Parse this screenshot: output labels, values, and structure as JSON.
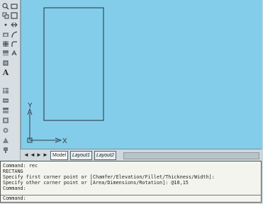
{
  "toolbar": {
    "tools": [
      {
        "name": "zoom-icon"
      },
      {
        "name": "rectangle-icon"
      },
      {
        "name": "copy-icon"
      },
      {
        "name": "rectangle-outline-icon"
      },
      {
        "name": "point-icon"
      },
      {
        "name": "stretch-icon"
      },
      {
        "name": "block-icon"
      },
      {
        "name": "arc-icon"
      },
      {
        "name": "hatch-icon"
      },
      {
        "name": "fillet-icon"
      },
      {
        "name": "gradient-icon"
      },
      {
        "name": "explode-icon"
      },
      {
        "name": "region-icon"
      },
      {
        "name": "text-letter",
        "label": "A"
      },
      {
        "name": "table-icon"
      },
      {
        "name": "dimension-icon"
      },
      {
        "name": "layer-icon"
      },
      {
        "name": "properties-icon"
      },
      {
        "name": "match-icon"
      },
      {
        "name": "measure-icon"
      },
      {
        "name": "paint-icon"
      }
    ]
  },
  "viewport": {
    "background": "#84cdea",
    "ucs": {
      "y_label": "Y",
      "x_label": "X"
    }
  },
  "layout_tabs": {
    "nav": [
      "◄",
      "◄",
      "►",
      "►"
    ],
    "tabs": [
      {
        "label": "Model",
        "active": true
      },
      {
        "label": "Layout1",
        "active": false
      },
      {
        "label": "Layout2",
        "active": false
      }
    ]
  },
  "command_history": [
    "Command: rec",
    "RECTANG",
    "Specify first corner point or [Chamfer/Elevation/Fillet/Thickness/Width]:",
    "Specify other corner point or [Area/Dimensions/Rotation]: @10,15",
    "Command:"
  ],
  "command_prompt": "Command:"
}
